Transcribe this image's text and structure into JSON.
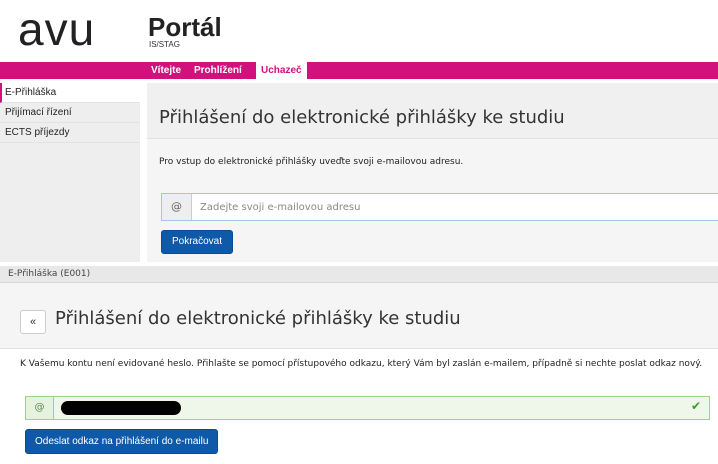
{
  "header": {
    "logo": "avu",
    "title": "Portál",
    "subtitle": "IS/STAG"
  },
  "nav": {
    "items": [
      {
        "label": "Vítejte"
      },
      {
        "label": "Prohlížení"
      },
      {
        "label": "Uchazeč"
      }
    ],
    "active_index": 2
  },
  "sidebar": {
    "items": [
      {
        "label": "E-Přihláška"
      },
      {
        "label": "Přijímací řízení"
      },
      {
        "label": "ECTS příjezdy"
      }
    ],
    "active_index": 0
  },
  "login": {
    "heading": "Přihlášení do elektronické přihlášky ke studiu",
    "intro": "Pro vstup do elektronické přihlášky uveďte svoji e-mailovou adresu.",
    "email_addon": "@",
    "email_placeholder": "Zadejte svoji e-mailovou adresu",
    "continue_label": "Pokračovat"
  },
  "second": {
    "breadcrumb": "E-Přihláška (E001)",
    "back_icon": "«",
    "heading": "Přihlášení do elektronické přihlášky ke studiu",
    "notice": "K Vašemu kontu není evidované heslo. Přihlašte se pomocí přístupového odkazu, který Vám byl zaslán e-mailem, případně si nechte poslat odkaz nový.",
    "email_addon": "@",
    "valid_icon": "✔",
    "send_label": "Odeslat odkaz na přihlášení do e-mailu"
  },
  "colors": {
    "brand": "#d1117e",
    "primary": "#0f5aa8",
    "success": "#3c9a2d"
  }
}
